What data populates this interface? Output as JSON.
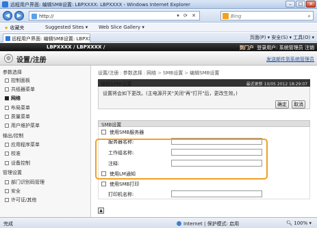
{
  "browser": {
    "window_title": "远程用户界面: 编辑SMB设置: LBPXXXX: LBPXXXX - Windows Internet Explorer",
    "url": "http://",
    "search_placeholder": "Bing",
    "favorites_label": "收藏夹",
    "suggested_sites": "Suggested Sites ▾",
    "web_slice": "Web Slice Gallery ▾",
    "tab_title": "远程用户界面: 编辑SMB设置: LBPXXXX: LBP...",
    "command_bar": "页面(P) ▾  安全(S) ▾  工具(O) ▾",
    "status_done": "完成",
    "status_zone": "Internet | 保护模式: 启用",
    "zoom": "100%"
  },
  "header": {
    "model": "LBPXXXX / LBPXXXX /",
    "portal_link": "到门户",
    "login_user": "登录用户: 系统管理员 注销",
    "page_title": "设置/注册",
    "mail_admin": "发送邮件到系统管理员"
  },
  "sidebar": {
    "sections": [
      {
        "title": "参数选择",
        "items": [
          "控制面板",
          "共纸器菜单",
          "网络",
          "布局菜单",
          "质量菜单",
          "用户维护菜单"
        ]
      },
      {
        "title": "输出/控制",
        "items": [
          "应用程序菜单",
          "校准",
          "设备控制"
        ]
      },
      {
        "title": "管理设置",
        "items": [
          "部门识别码管理",
          "安全",
          "许可证/其他"
        ]
      }
    ],
    "active_item": "网络"
  },
  "main": {
    "breadcrumb": [
      "设置/注册",
      "参数选择",
      "网络",
      "SMB设置",
      "编辑SMB设置"
    ],
    "edit_title": "编辑SMB设置",
    "last_updated": "最近更新 10/05 2012 18:29:07",
    "note": "设置将会如下更改。(主电源开关\"关闭\"再\"打开\"后，更改生效。)",
    "ok_button": "确定",
    "cancel_button": "取消",
    "smb_section": "SMB设置",
    "use_smb_server": "使用SMB服务器",
    "server_name_label": "服务器名称:",
    "workgroup_label": "工作组名称:",
    "comment_label": "注释:",
    "use_lm": "使用LM通知",
    "use_smb_print": "使用SMB打印",
    "printer_name_label": "打印机名称:",
    "fields": {
      "server_name": "",
      "workgroup": "",
      "comment": "",
      "printer_name": ""
    }
  }
}
